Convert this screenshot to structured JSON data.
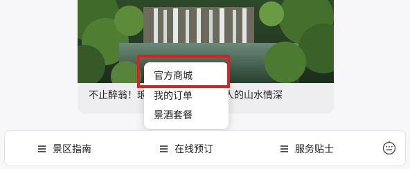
{
  "card": {
    "caption": "不止醉翁！琅琊山藏着欧阳修之人的山水情深"
  },
  "popup_menu": {
    "items": [
      {
        "label": "官方商城"
      },
      {
        "label": "我的订单"
      },
      {
        "label": "景酒套餐"
      }
    ]
  },
  "bottom_nav": {
    "items": [
      {
        "label": "景区指南",
        "icon": "menu-icon"
      },
      {
        "label": "在线预订",
        "icon": "menu-icon"
      },
      {
        "label": "服务贴士",
        "icon": "menu-icon"
      }
    ],
    "keyboard_icon": "keyboard-icon"
  },
  "colors": {
    "highlight": "#e02020",
    "background": "#f7f7f9"
  }
}
